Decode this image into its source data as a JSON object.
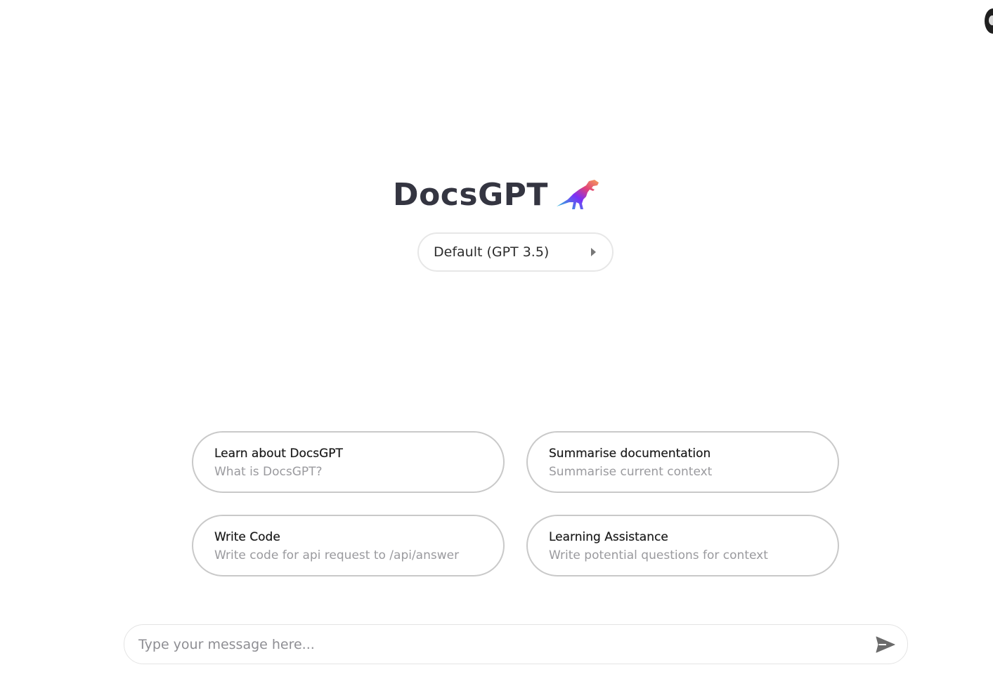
{
  "brand": {
    "title": "DocsGPT",
    "logo_icon": "dinosaur-logo-icon"
  },
  "model_selector": {
    "selected": "Default (GPT 3.5)",
    "icon": "caret-right-icon"
  },
  "prompts": [
    {
      "title": "Learn about DocsGPT",
      "subtitle": "What is DocsGPT?"
    },
    {
      "title": "Summarise documentation",
      "subtitle": "Summarise current context"
    },
    {
      "title": "Write Code",
      "subtitle": "Write code for api request to /api/answer"
    },
    {
      "title": "Learning Assistance",
      "subtitle": "Write potential questions for context"
    }
  ],
  "composer": {
    "placeholder": "Type your message here...",
    "send_icon": "send-icon"
  },
  "colors": {
    "title_text": "#343541",
    "card_border": "#c9c9c9",
    "muted_text": "#9a9a9e",
    "send_icon": "#6b6b6b"
  }
}
